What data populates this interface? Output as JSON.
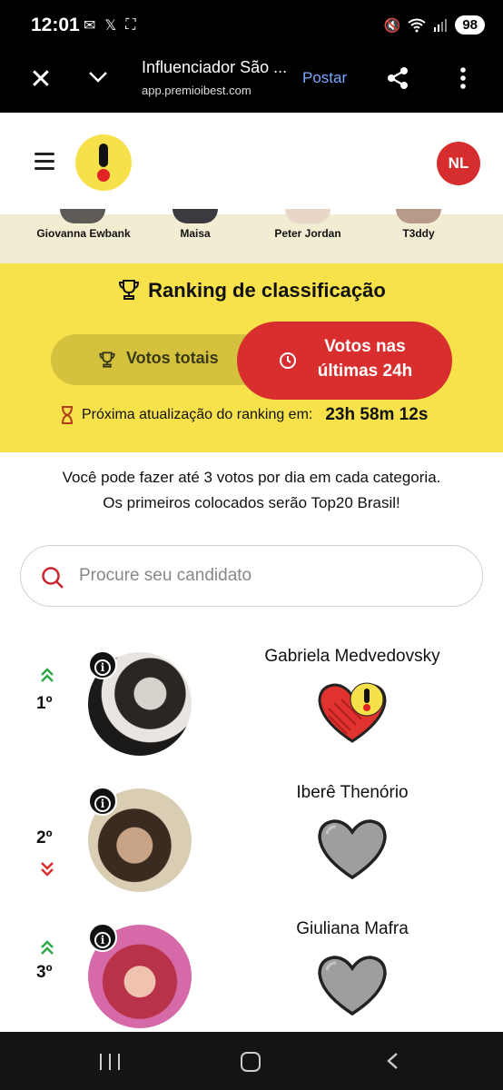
{
  "status_bar": {
    "time": "12:01",
    "battery": "98",
    "left_icons": [
      "notification-icon",
      "x-icon",
      "scan-icon"
    ]
  },
  "browser": {
    "title": "Influenciador São ...",
    "url": "app.premioibest.com",
    "post_label": "Postar"
  },
  "header": {
    "user_initials": "NL"
  },
  "carousel": {
    "names": [
      "Giovanna Ewbank",
      "Maisa",
      "Peter Jordan",
      "T3ddy"
    ]
  },
  "ranking": {
    "title": "Ranking de classificação",
    "tab_total": "Votos totais",
    "tab_24h": "Votos nas últimas 24h",
    "update_label": "Próxima atualização do ranking em:",
    "update_time": "23h 58m 12s"
  },
  "info": {
    "line1": "Você pode fazer até 3 votos por dia em cada categoria.",
    "line2": "Os primeiros colocados serão Top20 Brasil!"
  },
  "search": {
    "placeholder": "Procure seu candidato"
  },
  "candidates": [
    {
      "rank": "1º",
      "name": "Gabriela Medvedovsky",
      "trend": "up",
      "voted": true
    },
    {
      "rank": "2º",
      "name": "Iberê Thenório",
      "trend": "down",
      "voted": false
    },
    {
      "rank": "3º",
      "name": "Giuliana Mafra",
      "trend": "up",
      "voted": false
    }
  ],
  "colors": {
    "brand_yellow": "#f7e24c",
    "brand_red": "#d82e2e",
    "up_green": "#2ea84a",
    "down_red": "#d82e2e"
  }
}
